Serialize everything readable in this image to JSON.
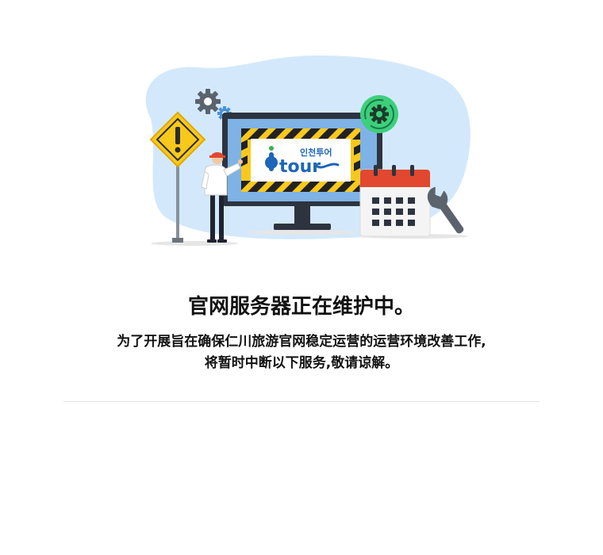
{
  "maintenance": {
    "title": "官网服务器正在维护中。",
    "description_line1": "为了开展旨在确保仁川旅游官网稳定运营的运营环境改善工作,",
    "description_line2": "将暂时中断以下服务,敬请谅解。",
    "logo": {
      "korean_text": "인천투어",
      "latin_text": "tour"
    }
  },
  "colors": {
    "blob": "#d3e9fb",
    "monitor_frame": "#2d3440",
    "screen": "#7fb2e5",
    "warning_yellow": "#f8c91c",
    "gear_green": "#3dcf7c",
    "calendar_red": "#e2472f",
    "logo_blue": "#1e66b8"
  },
  "icons": [
    "warning-sign-icon",
    "gear-icon",
    "refresh-gear-icon",
    "calendar-icon",
    "wrench-icon",
    "worker-figure"
  ]
}
